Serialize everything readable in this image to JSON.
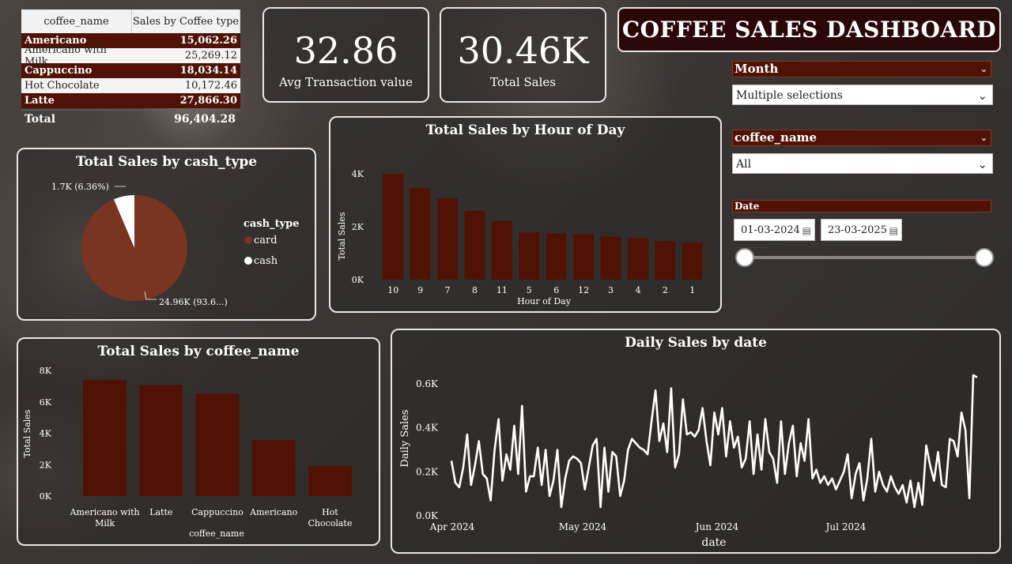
{
  "table": {
    "headers": [
      "coffee_name",
      "Sales by Coffee type"
    ],
    "rows": [
      {
        "name": "Americano",
        "value": "15,062.26"
      },
      {
        "name": "Americano with Milk",
        "value": "25,269.12"
      },
      {
        "name": "Cappuccino",
        "value": "18,034.14"
      },
      {
        "name": "Hot Chocolate",
        "value": "10,172.46"
      },
      {
        "name": "Latte",
        "value": "27,866.30"
      }
    ],
    "total_label": "Total",
    "total_value": "96,404.28"
  },
  "kpis": {
    "avg_value": "32.86",
    "avg_label": "Avg Transaction value",
    "sales_value": "30.46K",
    "sales_label": "Total Sales"
  },
  "banner": {
    "title": "COFFEE SALES DASHBOARD"
  },
  "slicers": {
    "month": {
      "label": "Month",
      "value": "Multiple selections"
    },
    "coffee": {
      "label": "coffee_name",
      "value": "All"
    },
    "date": {
      "label": "Date",
      "start": "01-03-2024",
      "end": "23-03-2025",
      "slider_start": 0,
      "slider_end": 1
    }
  },
  "colors": {
    "bar": "#4f1205",
    "card": "#7a3422",
    "cash": "#ffffff",
    "line": "#ffffff"
  },
  "chart_data": [
    {
      "type": "pie",
      "title": "Total Sales by cash_type",
      "legend_title": "cash_type",
      "legend_placement": "right",
      "slices": [
        {
          "name": "card",
          "value": 24960,
          "label": "24.96K (93.6...)"
        },
        {
          "name": "cash",
          "value": 1700,
          "label": "1.7K (6.36%)"
        }
      ]
    },
    {
      "type": "bar",
      "title": "Total Sales by Hour of Day",
      "xlabel": "Hour of Day",
      "ylabel": "Total Sales",
      "categories": [
        "10",
        "9",
        "7",
        "8",
        "11",
        "5",
        "6",
        "12",
        "3",
        "4",
        "2",
        "1"
      ],
      "values": [
        4000,
        3450,
        3070,
        2600,
        2220,
        1780,
        1750,
        1710,
        1620,
        1570,
        1460,
        1400
      ],
      "yticks": [
        "0K",
        "2K",
        "4K"
      ],
      "ylim": [
        0,
        4000
      ]
    },
    {
      "type": "bar",
      "title": "Total Sales by coffee_name",
      "xlabel": "coffee_name",
      "ylabel": "Total Sales",
      "categories": [
        "Americano with Milk",
        "Latte",
        "Cappuccino",
        "Americano",
        "Hot Chocolate"
      ],
      "values": [
        7400,
        7080,
        6520,
        3560,
        1920
      ],
      "yticks": [
        "0K",
        "2K",
        "4K",
        "6K",
        "8K"
      ],
      "ylim": [
        0,
        8000
      ]
    },
    {
      "type": "line",
      "title": "Daily Sales by date",
      "xlabel": "date",
      "ylabel": "Daily Sales",
      "xticks": [
        "Apr 2024",
        "May 2024",
        "Jun 2024",
        "Jul 2024"
      ],
      "yticks": [
        "0.0K",
        "0.2K",
        "0.4K",
        "0.6K"
      ],
      "ylim": [
        0,
        0.6
      ],
      "values": [
        0.25,
        0.15,
        0.13,
        0.22,
        0.37,
        0.14,
        0.23,
        0.34,
        0.19,
        0.17,
        0.07,
        0.3,
        0.44,
        0.16,
        0.28,
        0.21,
        0.41,
        0.19,
        0.5,
        0.11,
        0.18,
        0.18,
        0.31,
        0.14,
        0.3,
        0.09,
        0.16,
        0.3,
        0.04,
        0.17,
        0.25,
        0.27,
        0.26,
        0.24,
        0.12,
        0.22,
        0.32,
        0.35,
        0.04,
        0.31,
        0.11,
        0.29,
        0.27,
        0.09,
        0.16,
        0.3,
        0.35,
        0.33,
        0.31,
        0.3,
        0.28,
        0.43,
        0.57,
        0.34,
        0.42,
        0.29,
        0.58,
        0.22,
        0.28,
        0.53,
        0.37,
        0.38,
        0.36,
        0.39,
        0.49,
        0.34,
        0.23,
        0.47,
        0.37,
        0.49,
        0.27,
        0.43,
        0.31,
        0.36,
        0.22,
        0.26,
        0.43,
        0.19,
        0.37,
        0.21,
        0.44,
        0.29,
        0.26,
        0.15,
        0.43,
        0.19,
        0.33,
        0.41,
        0.18,
        0.33,
        0.25,
        0.44,
        0.17,
        0.21,
        0.15,
        0.18,
        0.14,
        0.17,
        0.12,
        0.16,
        0.2,
        0.28,
        0.08,
        0.19,
        0.24,
        0.07,
        0.17,
        0.35,
        0.11,
        0.2,
        0.14,
        0.11,
        0.18,
        0.13,
        0.1,
        0.14,
        0.06,
        0.16,
        0.04,
        0.15,
        0.05,
        0.32,
        0.23,
        0.16,
        0.29,
        0.14,
        0.13,
        0.35,
        0.34,
        0.27,
        0.47,
        0.39,
        0.08,
        0.64,
        0.63
      ]
    }
  ]
}
